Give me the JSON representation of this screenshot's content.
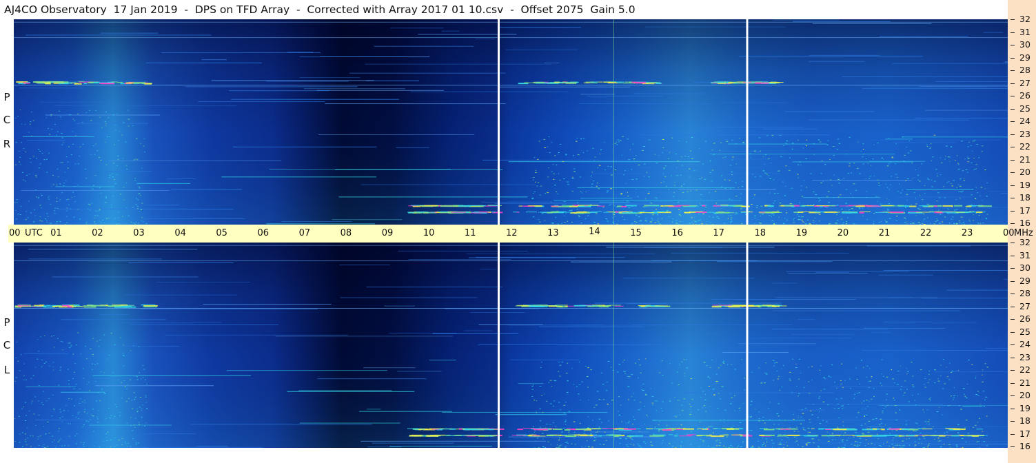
{
  "header": {
    "title": "AJ4CO Observatory  17 Jan 2019  -  DPS on TFD Array  -  Corrected with Array 2017 01 10.csv  -  Offset 2075  Gain 5.0"
  },
  "colors": {
    "background_low": "#000c3a",
    "background_mid": "#0b2a8e",
    "background_high": "#1b63d8",
    "emission_cyan": "#33d6e6",
    "emission_green": "#7be08a",
    "emission_yellow": "#f2f04a",
    "emission_magenta": "#ff40c8",
    "time_band": "#ffffc0",
    "frequency_strip": "#fde1c5",
    "gap_marker": "#ffffff"
  },
  "chart_data": [
    {
      "type": "heatmap",
      "title": "AJ4CO Observatory  17 Jan 2019  -  DPS on TFD Array  -  Corrected with Array 2017 01 10.csv  -  Offset 2075  Gain 5.0",
      "panel": "RCP",
      "ylabel_letters": [
        "P",
        "C",
        "R"
      ],
      "xlabel": "UTC",
      "ylabel": "MHz",
      "x_ticks": [
        "00",
        "01",
        "02",
        "03",
        "04",
        "05",
        "06",
        "07",
        "08",
        "09",
        "10",
        "11",
        "12",
        "13",
        "14",
        "15",
        "16",
        "17",
        "18",
        "19",
        "20",
        "21",
        "22",
        "23",
        "00"
      ],
      "y_ticks": [
        "16",
        "17",
        "18",
        "19",
        "20",
        "21",
        "22",
        "23",
        "24",
        "25",
        "26",
        "27",
        "28",
        "29",
        "30",
        "31",
        "32"
      ],
      "xlim_hours": [
        0,
        24
      ],
      "ylim_mhz": [
        16,
        32
      ],
      "gap_markers_utc_hours": [
        11.7,
        17.7
      ],
      "bright_bands_mhz": [
        27.1,
        17.5,
        17.0
      ],
      "quiet_period_utc_hours": [
        6.8,
        9.0
      ]
    },
    {
      "type": "heatmap",
      "panel": "LCP",
      "ylabel_letters": [
        "P",
        "C",
        "L"
      ],
      "xlabel": "UTC",
      "ylabel": "MHz",
      "x_ticks": [
        "00",
        "01",
        "02",
        "03",
        "04",
        "05",
        "06",
        "07",
        "08",
        "09",
        "10",
        "11",
        "12",
        "13",
        "14",
        "15",
        "16",
        "17",
        "18",
        "19",
        "20",
        "21",
        "22",
        "23",
        "00"
      ],
      "y_ticks": [
        "16",
        "17",
        "18",
        "19",
        "20",
        "21",
        "22",
        "23",
        "24",
        "25",
        "26",
        "27",
        "28",
        "29",
        "30",
        "31",
        "32"
      ],
      "xlim_hours": [
        0,
        24
      ],
      "ylim_mhz": [
        16,
        32
      ],
      "gap_markers_utc_hours": [
        11.7,
        17.7
      ],
      "bright_bands_mhz": [
        27.1,
        17.5,
        17.0
      ],
      "quiet_period_utc_hours": [
        6.8,
        9.0
      ]
    }
  ],
  "axis": {
    "utc_label": "UTC",
    "mhz_label": "MHz",
    "hours": [
      "00",
      "01",
      "02",
      "03",
      "04",
      "05",
      "06",
      "07",
      "08",
      "09",
      "10",
      "11",
      "12",
      "13",
      "14",
      "15",
      "16",
      "17",
      "18",
      "19",
      "20",
      "21",
      "22",
      "23",
      "00"
    ],
    "freqs": [
      "32",
      "31",
      "30",
      "29",
      "28",
      "27",
      "26",
      "25",
      "24",
      "23",
      "22",
      "21",
      "20",
      "19",
      "18",
      "17",
      "16"
    ]
  },
  "rcp": {
    "letters": [
      "P",
      "C",
      "R"
    ]
  },
  "lcp": {
    "letters": [
      "P",
      "C",
      "L"
    ]
  }
}
